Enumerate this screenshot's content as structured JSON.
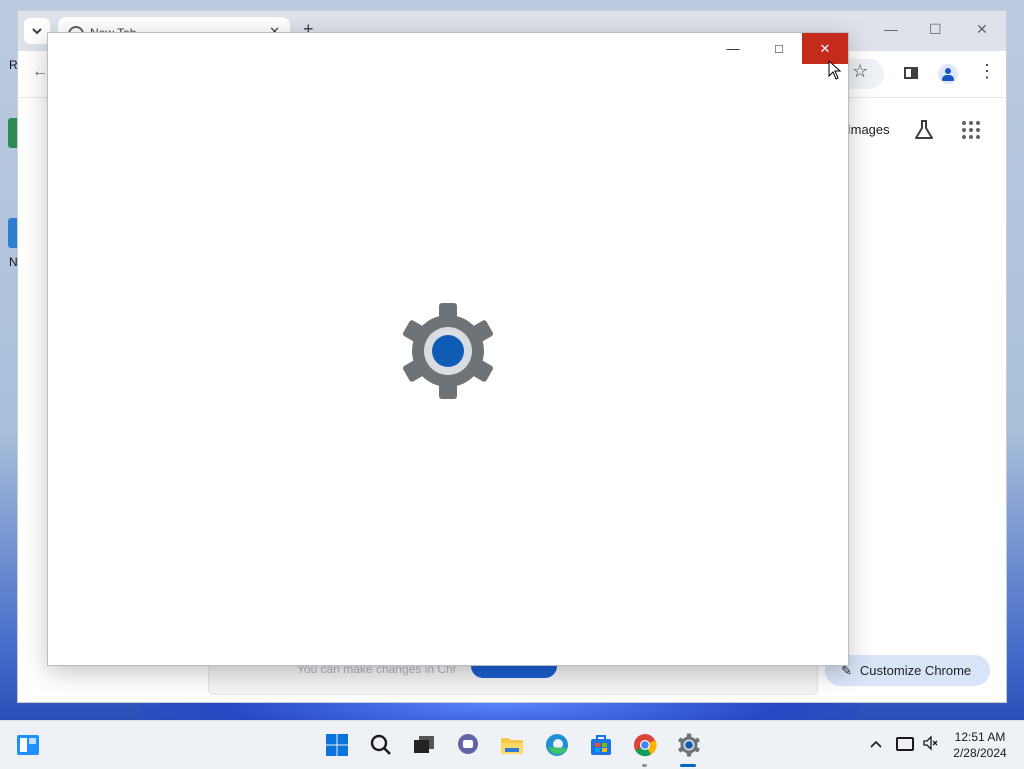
{
  "desktop": {
    "icon_labels": [
      "R",
      "N"
    ]
  },
  "chrome": {
    "tab_title": "New Tab",
    "tab_close": "✕",
    "new_tab": "+",
    "window_controls": {
      "minimize": "—",
      "maximize": "☐",
      "close": "✕"
    },
    "back": "←",
    "star": "☆",
    "menu": "⋮",
    "images_link": "Images",
    "customize_label": "Customize Chrome",
    "card_text": "You can make changes in Chr"
  },
  "settings_window": {
    "controls": {
      "minimize": "—",
      "maximize": "□",
      "close": "✕"
    },
    "splash_icon": "gear-icon",
    "colors": {
      "close_bg": "#c42b1c",
      "gear_body": "#6e7378",
      "gear_center": "#0f5bb5"
    }
  },
  "taskbar": {
    "pinned": [
      "start",
      "search",
      "task-view",
      "teams-chat",
      "file-explorer",
      "edge",
      "microsoft-store",
      "chrome",
      "settings"
    ],
    "tray_chevron": "^",
    "clock_time": "12:51 AM",
    "clock_date": "2/28/2024",
    "accent": "#0067c0"
  }
}
